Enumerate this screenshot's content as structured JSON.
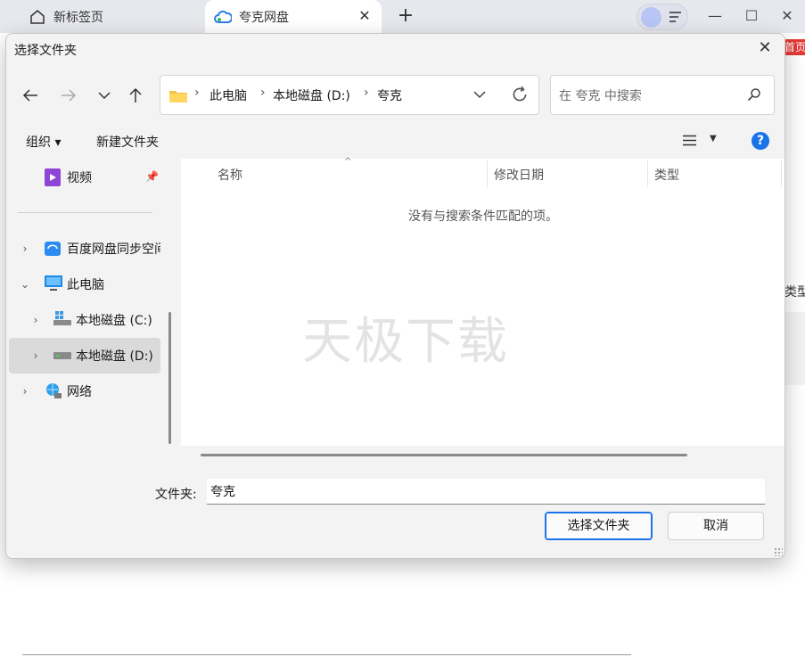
{
  "browser": {
    "tabs": [
      {
        "label": "新标签页",
        "icon": "home-icon"
      },
      {
        "label": "夸克网盘",
        "icon": "quark-cloud-icon"
      }
    ],
    "new_tab": "+",
    "tab_close": "✕",
    "window_controls": {
      "minimize": "—",
      "maximize": "☐",
      "close": "✕"
    }
  },
  "background_page": {
    "badge": "首页",
    "column_type": "类型"
  },
  "dialog": {
    "title": "选择文件夹",
    "close": "✕",
    "nav": {
      "back": "back-arrow-icon",
      "forward": "forward-arrow-icon",
      "recent": "chevron-down-icon",
      "up": "up-arrow-icon"
    },
    "breadcrumb": [
      "此电脑",
      "本地磁盘 (D:)",
      "夸克"
    ],
    "breadcrumb_sep": "›",
    "search_placeholder": "在 夸克 中搜索",
    "toolbar": {
      "organize": "组织 ▾",
      "new_folder": "新建文件夹",
      "help": "?"
    },
    "nav_pane": [
      {
        "label": "视频",
        "icon": "video-folder-icon",
        "pinned": true
      },
      {
        "label": "百度网盘同步空间",
        "icon": "baidu-netdisk-icon"
      },
      {
        "label": "此电脑",
        "icon": "computer-icon",
        "expanded": true
      },
      {
        "label": "本地磁盘 (C:)",
        "icon": "drive-c-icon"
      },
      {
        "label": "本地磁盘 (D:)",
        "icon": "drive-d-icon",
        "selected": true
      },
      {
        "label": "网络",
        "icon": "network-icon"
      }
    ],
    "columns": [
      "名称",
      "修改日期",
      "类型"
    ],
    "empty_message": "没有与搜索条件匹配的项。",
    "watermark": "天极下载",
    "folder_label": "文件夹:",
    "folder_value": "夸克",
    "select_button": "选择文件夹",
    "cancel_button": "取消"
  }
}
